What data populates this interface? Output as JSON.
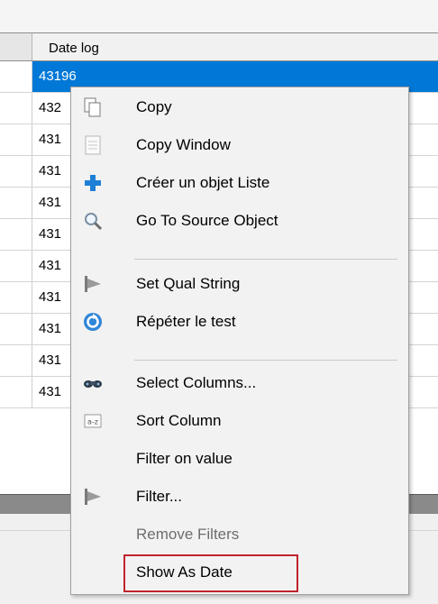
{
  "grid": {
    "column_header": "Date log",
    "selected_row_value": "43196",
    "rows": [
      "432",
      "431",
      "431",
      "431",
      "431",
      "431",
      "431",
      "431",
      "431",
      "431"
    ]
  },
  "context_menu": {
    "items": [
      {
        "label": "Copy",
        "icon": "copy-icon",
        "enabled": true
      },
      {
        "label": "Copy Window",
        "icon": "document-icon",
        "enabled": true
      },
      {
        "label": "Créer un objet Liste",
        "icon": "plus-icon",
        "enabled": true
      },
      {
        "label": "Go To Source Object",
        "icon": "magnifier-icon",
        "enabled": true
      },
      {
        "label": "Set Qual String",
        "icon": "flag-icon",
        "enabled": true
      },
      {
        "label": "Répéter le test",
        "icon": "refresh-icon",
        "enabled": true
      },
      {
        "label": "Select Columns...",
        "icon": "binoculars-icon",
        "enabled": true
      },
      {
        "label": "Sort Column",
        "icon": "sort-az-icon",
        "enabled": true
      },
      {
        "label": "Filter on value",
        "icon": "",
        "enabled": true
      },
      {
        "label": "Filter...",
        "icon": "flag-icon",
        "enabled": true
      },
      {
        "label": "Remove Filters",
        "icon": "",
        "enabled": false
      },
      {
        "label": "Show As Date",
        "icon": "",
        "enabled": true
      }
    ]
  },
  "colors": {
    "selection": "#0078d7",
    "highlight_box": "#c0232c"
  }
}
